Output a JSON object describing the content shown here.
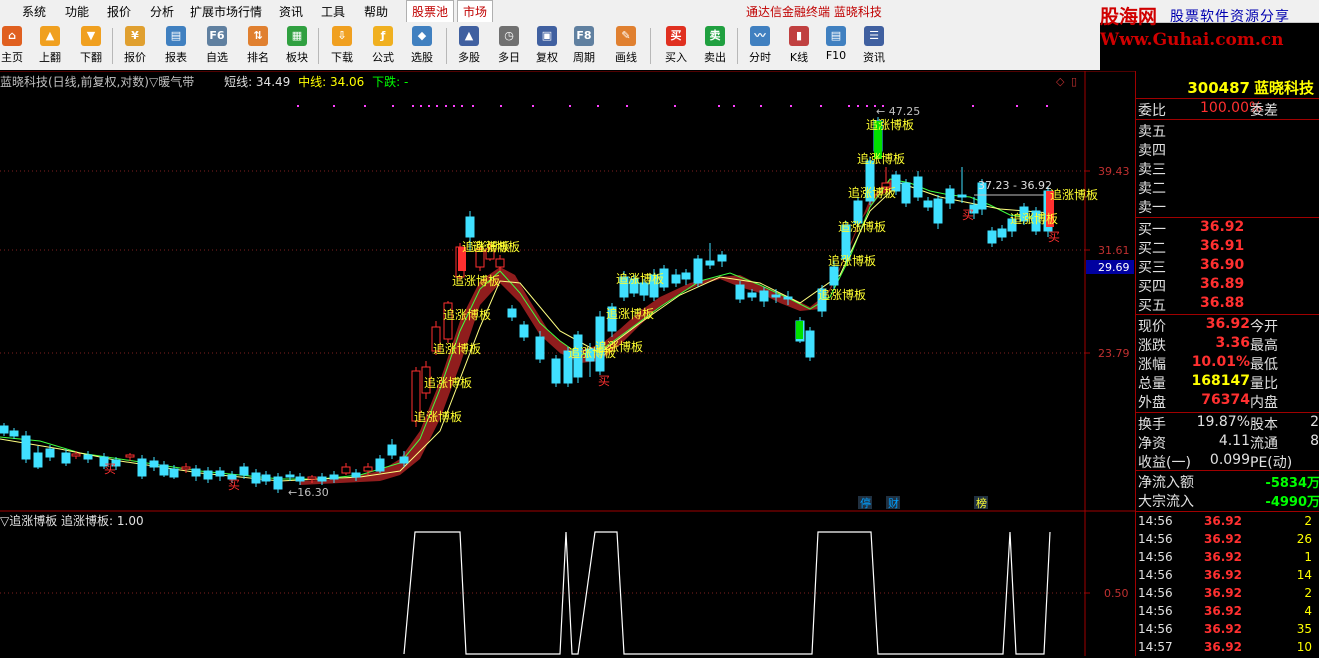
{
  "menu": {
    "items": [
      "系统",
      "功能",
      "报价",
      "分析",
      "扩展市场行情",
      "资讯",
      "工具",
      "帮助"
    ],
    "tabs": [
      "股票池",
      "市场"
    ],
    "title": "通达信金融终端  蓝晓科技"
  },
  "brand": {
    "logo": "股海网",
    "slogan": "股票软件资源分享",
    "url": "Www.Guhai.com.cn"
  },
  "toolbar": {
    "buttons": [
      {
        "label": "主页",
        "icon": "home-icon",
        "color": "#e06020"
      },
      {
        "label": "上翻",
        "icon": "arrow-up-icon",
        "color": "#f0a020"
      },
      {
        "label": "下翻",
        "icon": "arrow-down-icon",
        "color": "#f0a020"
      },
      {
        "label": "报价",
        "icon": "quote-icon",
        "color": "#e0a030"
      },
      {
        "label": "报表",
        "icon": "report-icon",
        "color": "#4080c0"
      },
      {
        "label": "自选",
        "icon": "f6-icon",
        "color": "#6080a0"
      },
      {
        "label": "排名",
        "icon": "rank-icon",
        "color": "#e08030"
      },
      {
        "label": "板块",
        "icon": "sector-icon",
        "color": "#30a040"
      },
      {
        "label": "下载",
        "icon": "download-icon",
        "color": "#f0a020"
      },
      {
        "label": "公式",
        "icon": "formula-icon",
        "color": "#f0b020"
      },
      {
        "label": "选股",
        "icon": "pick-stock-icon",
        "color": "#4080c0"
      },
      {
        "label": "多股",
        "icon": "multi-stock-icon",
        "color": "#4060a0"
      },
      {
        "label": "多日",
        "icon": "multi-day-icon",
        "color": "#707070"
      },
      {
        "label": "复权",
        "icon": "restore-icon",
        "color": "#4060a0"
      },
      {
        "label": "周期",
        "icon": "f8-icon",
        "color": "#6080a0"
      },
      {
        "label": "画线",
        "icon": "draw-line-icon",
        "color": "#e08030"
      },
      {
        "label": "买入",
        "icon": "buy-icon",
        "color": "#e03020"
      },
      {
        "label": "卖出",
        "icon": "sell-icon",
        "color": "#20a040"
      },
      {
        "label": "分时",
        "icon": "timeshare-icon",
        "color": "#4080c0"
      },
      {
        "label": "K线",
        "icon": "kline-icon",
        "color": "#c04040"
      },
      {
        "label": "F10",
        "icon": "f10-icon",
        "color": "#4080c0"
      },
      {
        "label": "资讯",
        "icon": "news-icon",
        "color": "#4060a0"
      }
    ]
  },
  "chart_header": {
    "name": "蓝晓科技(日线,前复权,对数)▽暖气带",
    "short": "短线: 34.49",
    "mid": "中线: 34.06",
    "down": "下跌: -"
  },
  "indicator_header": "▽追涨博板 追涨博板: 1.00",
  "chart_data": {
    "type": "candlestick",
    "price_axis_labels": [
      "39.43",
      "31.61",
      "29.69",
      "23.79"
    ],
    "indicator_axis_labels": [
      "0.50"
    ],
    "annotations": {
      "high": "← 47.25",
      "low": "←16.30",
      "range": "37.23 - 36.92",
      "signal_label": "追涨博板",
      "buy_label": "买",
      "event_tags": [
        "停",
        "财",
        "榜"
      ]
    },
    "signal": [
      0,
      0,
      0,
      0,
      0,
      0,
      0,
      0,
      0,
      0,
      0,
      0,
      0,
      0,
      0,
      0,
      0,
      0,
      0,
      0,
      0,
      0,
      0,
      0,
      0,
      0,
      0,
      0,
      0,
      0,
      0,
      0,
      0,
      0,
      0,
      0,
      0,
      0,
      0,
      0,
      0,
      1,
      1,
      1,
      1,
      1,
      1,
      0,
      0,
      0,
      0,
      0,
      0,
      0,
      0,
      0,
      0,
      1,
      0,
      0,
      1,
      1,
      1,
      0,
      0,
      0,
      0,
      0,
      0,
      0,
      0,
      0,
      0,
      0,
      0,
      0,
      0,
      0,
      0,
      0,
      0,
      0,
      1,
      1,
      1,
      1,
      1,
      1,
      0,
      0,
      0,
      0,
      0,
      0,
      0,
      0,
      0,
      0,
      0,
      0,
      1,
      0,
      0,
      0,
      1
    ],
    "marker_colors": {
      "up": "#ff3030",
      "down": "#40e0ff",
      "band": "#a02020",
      "short": "#40ff40",
      "mid": "#ffff80"
    }
  },
  "quote": {
    "code": "300487",
    "name": "蓝晓科技",
    "weibi_label": "委比",
    "weibi": "100.00%",
    "weicha_label": "委差",
    "sells": [
      "卖五",
      "卖四",
      "卖三",
      "卖二",
      "卖一"
    ],
    "buys": [
      {
        "label": "买一",
        "price": "36.92"
      },
      {
        "label": "买二",
        "price": "36.91"
      },
      {
        "label": "买三",
        "price": "36.90"
      },
      {
        "label": "买四",
        "price": "36.89"
      },
      {
        "label": "买五",
        "price": "36.88"
      }
    ],
    "stats": [
      {
        "l1": "现价",
        "v1": "36.92",
        "c1": "red",
        "l2": "今开"
      },
      {
        "l1": "涨跌",
        "v1": "3.36",
        "c1": "red",
        "l2": "最高"
      },
      {
        "l1": "涨幅",
        "v1": "10.01%",
        "c1": "red",
        "l2": "最低"
      },
      {
        "l1": "总量",
        "v1": "168147",
        "c1": "yellow",
        "l2": "量比"
      },
      {
        "l1": "外盘",
        "v1": "76374",
        "c1": "red",
        "l2": "内盘"
      }
    ],
    "stats2": [
      {
        "l1": "换手",
        "v1": "19.87%",
        "c1": "white",
        "l2": "股本",
        "v2": "2"
      },
      {
        "l1": "净资",
        "v1": "4.11",
        "c1": "white",
        "l2": "流通",
        "v2": "8"
      },
      {
        "l1": "收益(一)",
        "v1": "0.099",
        "c1": "white",
        "l2": "PE(动)",
        "v2": ""
      }
    ],
    "flows": [
      {
        "label": "净流入额",
        "value": "-5834万"
      },
      {
        "label": "大宗流入",
        "value": "-4990万"
      }
    ],
    "ticks": [
      {
        "time": "14:56",
        "price": "36.92",
        "vol": "2"
      },
      {
        "time": "14:56",
        "price": "36.92",
        "vol": "26"
      },
      {
        "time": "14:56",
        "price": "36.92",
        "vol": "1"
      },
      {
        "time": "14:56",
        "price": "36.92",
        "vol": "14"
      },
      {
        "time": "14:56",
        "price": "36.92",
        "vol": "2"
      },
      {
        "time": "14:56",
        "price": "36.92",
        "vol": "4"
      },
      {
        "time": "14:56",
        "price": "36.92",
        "vol": "35"
      },
      {
        "time": "14:57",
        "price": "36.92",
        "vol": "10"
      }
    ]
  }
}
